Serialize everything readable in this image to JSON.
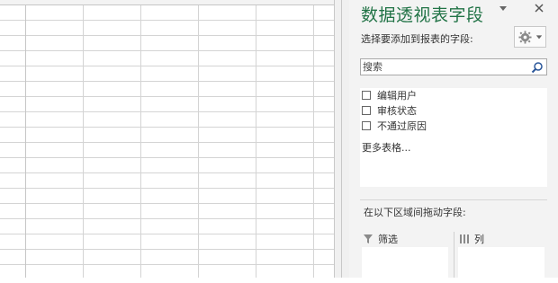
{
  "pane": {
    "title": "数据透视表字段",
    "dropdown_icon": "triangle-down-icon",
    "close_icon": "close-icon",
    "choose_label": "选择要添加到报表的字段:",
    "gear_icon": "gear-icon",
    "search": {
      "placeholder": "搜索",
      "value": "",
      "icon": "magnifier-icon"
    },
    "fields": [
      {
        "label": "编辑用户",
        "checked": false
      },
      {
        "label": "审核状态",
        "checked": false
      },
      {
        "label": "不通过原因",
        "checked": false
      }
    ],
    "more_tables": "更多表格...",
    "drag_label": "在以下区域间拖动字段:",
    "areas": [
      {
        "label": "筛选",
        "icon": "filter-icon"
      },
      {
        "label": "列",
        "icon": "columns-icon"
      }
    ],
    "accent_color": "#217346"
  }
}
